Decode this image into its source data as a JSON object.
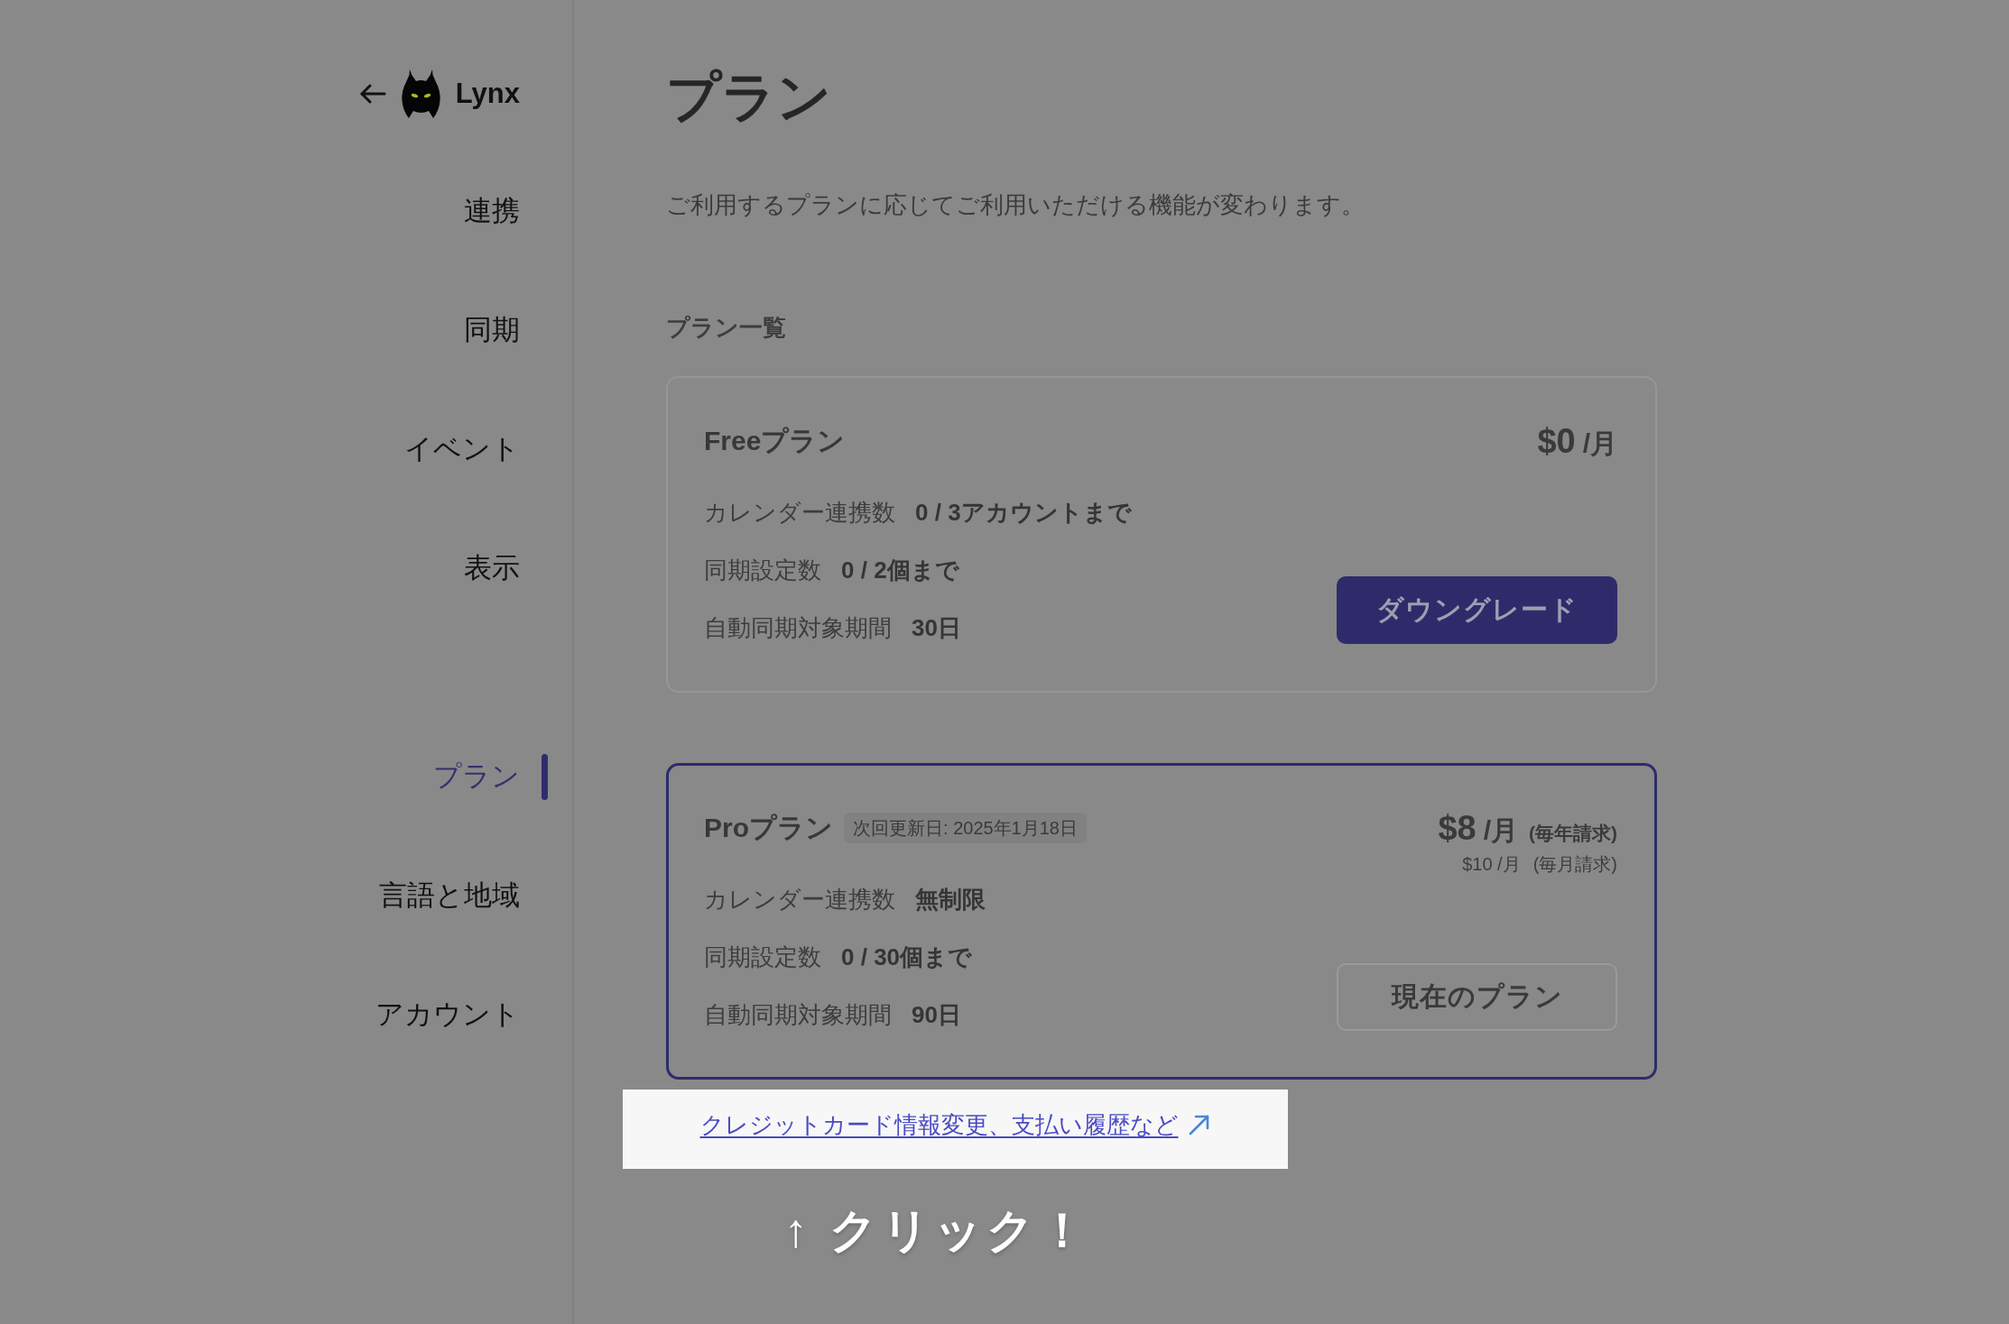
{
  "sidebar": {
    "brand": {
      "name": "Lynx"
    },
    "groups": [
      {
        "items": [
          {
            "label": "連携",
            "selected": false
          },
          {
            "label": "同期",
            "selected": false
          },
          {
            "label": "イベント",
            "selected": false
          },
          {
            "label": "表示",
            "selected": false
          }
        ]
      },
      {
        "items": [
          {
            "label": "プラン",
            "selected": true
          },
          {
            "label": "言語と地域",
            "selected": false
          },
          {
            "label": "アカウント",
            "selected": false
          }
        ]
      }
    ]
  },
  "page": {
    "title": "プラン",
    "description": "ご利用するプランに応じてご利用いただける機能が変わります。"
  },
  "plan_list": {
    "heading": "プラン一覧",
    "plans": [
      {
        "name": "Freeプラン",
        "current": false,
        "price": {
          "amount": "$0",
          "unit": "/月"
        },
        "features": [
          {
            "label": "カレンダー連携数",
            "value": "0 / 3アカウントまで"
          },
          {
            "label": "同期設定数",
            "value": "0 / 2個まで"
          },
          {
            "label": "自動同期対象期間",
            "value": "30日"
          }
        ],
        "action": {
          "label": "ダウングレード",
          "kind": "primary"
        }
      },
      {
        "name": "Proプラン",
        "current": true,
        "badge": "次回更新日: 2025年1月18日",
        "price": {
          "amount": "$8",
          "unit": "/月",
          "note": "(毎年請求)"
        },
        "alt_price": {
          "amount": "$10 /月",
          "note": "(毎月請求)"
        },
        "features": [
          {
            "label": "カレンダー連携数",
            "value": "無制限"
          },
          {
            "label": "同期設定数",
            "value": "0 / 30個まで"
          },
          {
            "label": "自動同期対象期間",
            "value": "90日"
          }
        ],
        "action": {
          "label": "現在のプラン",
          "kind": "outline"
        }
      }
    ]
  },
  "billing_link": {
    "label": "クレジットカード情報変更、支払い履歴など",
    "highlighted": true
  },
  "callout": {
    "text": "↑ クリック！"
  }
}
